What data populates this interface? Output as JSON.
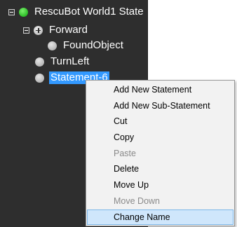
{
  "tree": {
    "root": {
      "label": "RescuBot World1 State",
      "icon": "green-circle-icon",
      "color": "#2bbd27"
    },
    "forward": {
      "label": "Forward",
      "icon": "plus-circle-icon"
    },
    "found_object": {
      "label": "FoundObject",
      "icon": "gray-circle-icon"
    },
    "turn_left": {
      "label": "TurnLeft",
      "icon": "gray-circle-icon"
    },
    "statement": {
      "label": "Statement-6",
      "icon": "gray-circle-icon",
      "selected": true
    }
  },
  "context_menu": {
    "items": [
      {
        "label": "Add New Statement",
        "enabled": true
      },
      {
        "label": "Add New Sub-Statement",
        "enabled": true
      },
      {
        "label": "Cut",
        "enabled": true
      },
      {
        "label": "Copy",
        "enabled": true
      },
      {
        "label": "Paste",
        "enabled": false
      },
      {
        "label": "Delete",
        "enabled": true
      },
      {
        "label": "Move Up",
        "enabled": true
      },
      {
        "label": "Move Down",
        "enabled": false
      },
      {
        "label": "Change Name",
        "enabled": true,
        "highlighted": true
      }
    ]
  },
  "colors": {
    "panel_background": "#2e2e2e",
    "selection": "#3399ff",
    "menu_highlight": "#cfe6fb"
  }
}
